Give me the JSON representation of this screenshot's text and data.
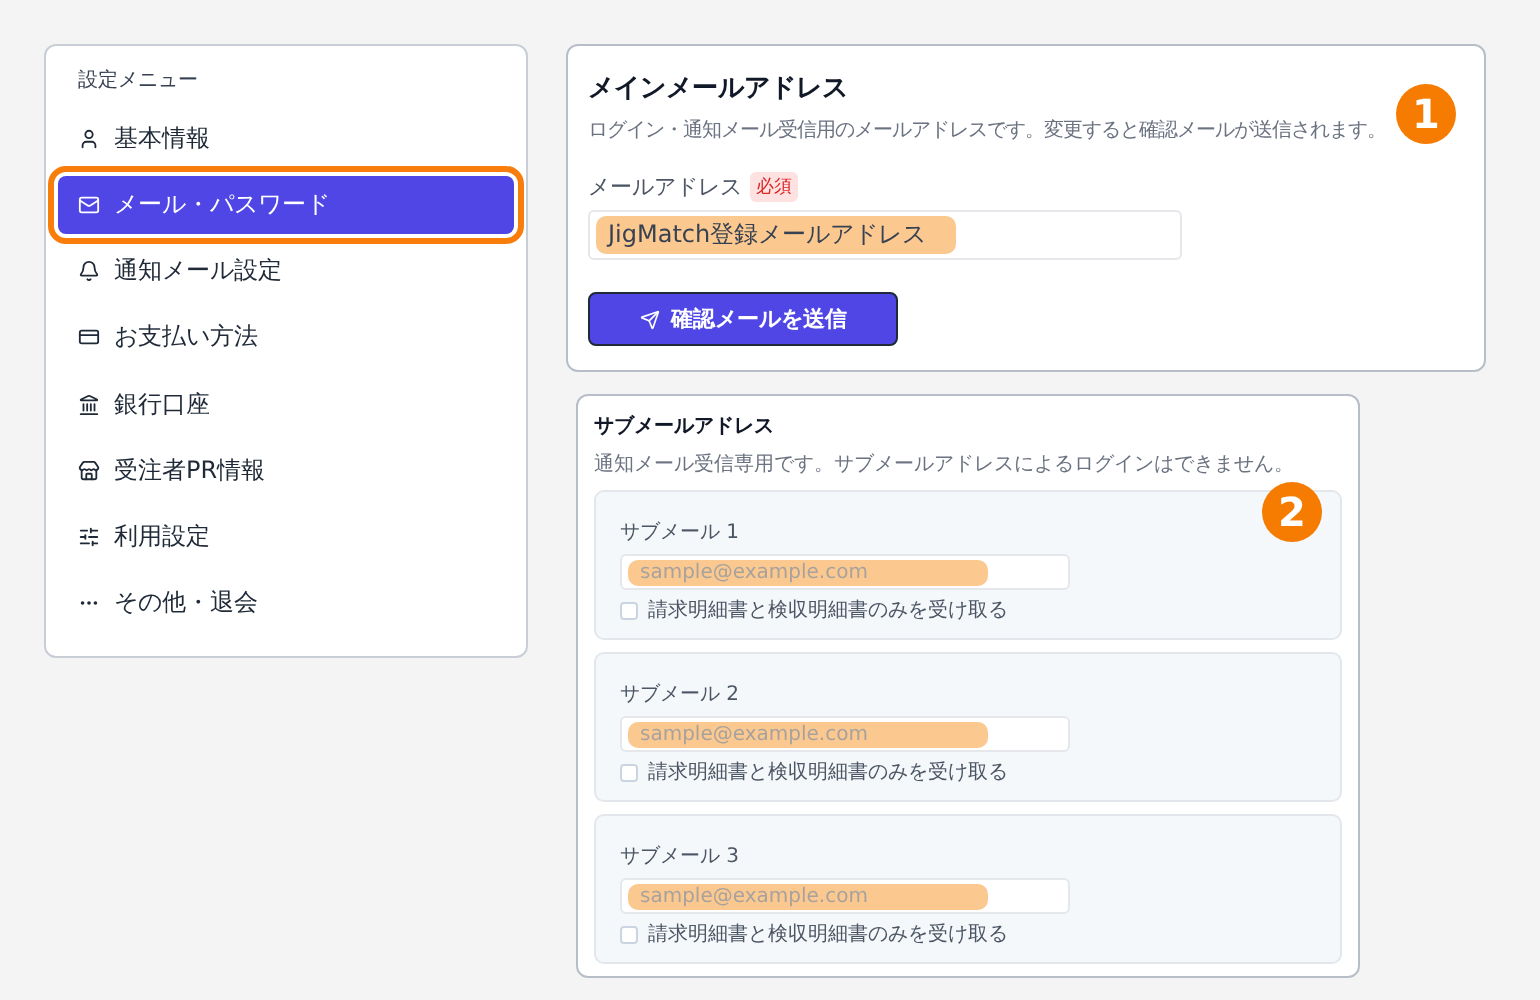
{
  "sidebar": {
    "title": "設定メニュー",
    "items": [
      {
        "label": "基本情報",
        "selected": false
      },
      {
        "label": "メール・パスワード",
        "selected": true
      },
      {
        "label": "通知メール設定",
        "selected": false
      },
      {
        "label": "お支払い方法",
        "selected": false
      },
      {
        "label": "銀行口座",
        "selected": false
      },
      {
        "label": "受注者PR情報",
        "selected": false
      },
      {
        "label": "利用設定",
        "selected": false
      },
      {
        "label": "その他・退会",
        "selected": false
      }
    ]
  },
  "main_email": {
    "title": "メインメールアドレス",
    "description": "ログイン・通知メール受信用のメールアドレスです。変更すると確認メールが送信されます。",
    "field_label": "メールアドレス",
    "required_badge": "必須",
    "value": "JigMatch登録メールアドレス",
    "button": "確認メールを送信",
    "annotation": "1"
  },
  "sub_email": {
    "title": "サブメールアドレス",
    "description": "通知メール受信専用です。サブメールアドレスによるログインはできません。",
    "annotation": "2",
    "entries": [
      {
        "label": "サブメール 1",
        "placeholder": "sample@example.com",
        "checkbox_label": "請求明細書と検収明細書のみを受け取る",
        "checked": false
      },
      {
        "label": "サブメール 2",
        "placeholder": "sample@example.com",
        "checkbox_label": "請求明細書と検収明細書のみを受け取る",
        "checked": false
      },
      {
        "label": "サブメール 3",
        "placeholder": "sample@example.com",
        "checkbox_label": "請求明細書と検収明細書のみを受け取る",
        "checked": false
      }
    ]
  }
}
